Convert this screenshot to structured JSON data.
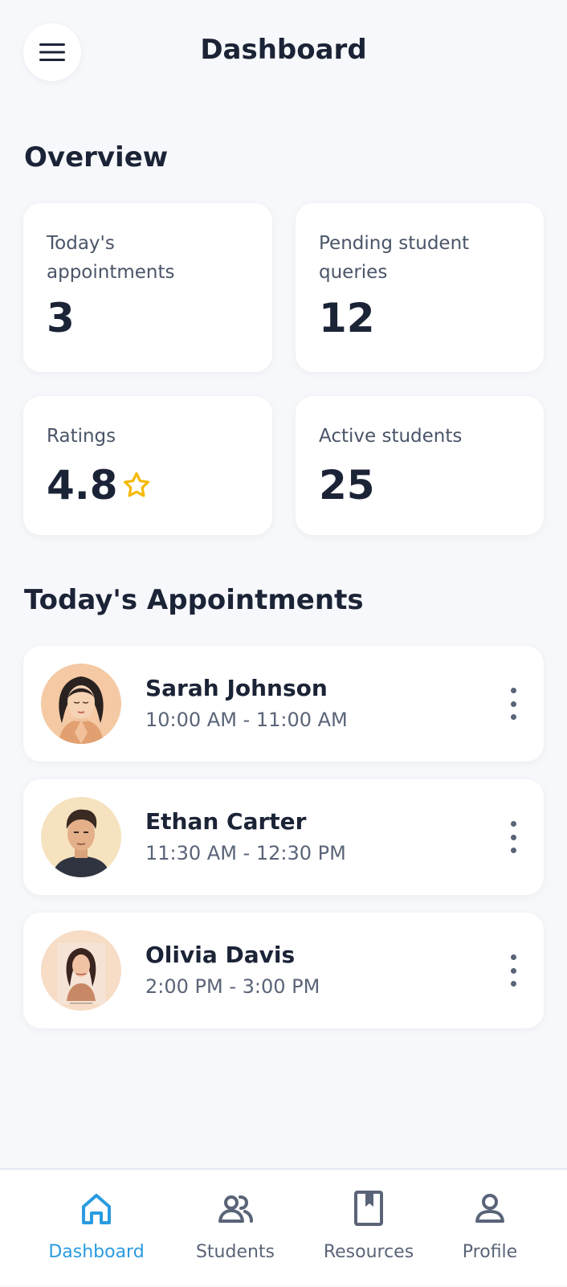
{
  "header": {
    "title": "Dashboard",
    "menu_icon": "hamburger-menu-icon"
  },
  "overview": {
    "title": "Overview",
    "cards": [
      {
        "label": "Today's appointments",
        "value": "3"
      },
      {
        "label": "Pending student queries",
        "value": "12"
      },
      {
        "label": "Ratings",
        "value": "4.8",
        "icon": "star-outline-icon"
      },
      {
        "label": "Active students",
        "value": "25"
      }
    ]
  },
  "appointments": {
    "title": "Today's Appointments",
    "items": [
      {
        "name": "Sarah Johnson",
        "time": "10:00 AM - 11:00 AM"
      },
      {
        "name": "Ethan Carter",
        "time": "11:30 AM - 12:30 PM"
      },
      {
        "name": "Olivia Davis",
        "time": "2:00 PM - 3:00 PM"
      }
    ]
  },
  "nav": {
    "active": "Dashboard",
    "items": [
      {
        "label": "Dashboard",
        "icon": "home-icon"
      },
      {
        "label": "Students",
        "icon": "users-icon"
      },
      {
        "label": "Resources",
        "icon": "bookmark-book-icon"
      },
      {
        "label": "Profile",
        "icon": "user-icon"
      }
    ]
  },
  "colors": {
    "background": "#f7f8fb",
    "text_primary": "#1b2336",
    "text_secondary": "#5a6478",
    "accent": "#2a9be0",
    "star": "#f5b800"
  }
}
